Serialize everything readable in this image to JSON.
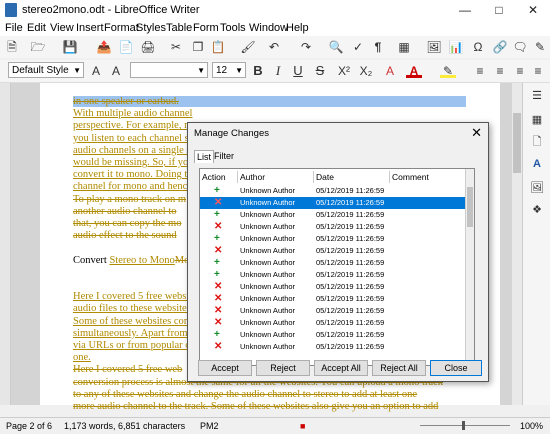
{
  "window": {
    "title": "stereo2mono.odt - LibreOffice Writer"
  },
  "menu": [
    "File",
    "Edit",
    "View",
    "Insert",
    "Format",
    "Styles",
    "Table",
    "Form",
    "Tools",
    "Window",
    "Help"
  ],
  "formatting": {
    "paragraph_style": "Default Style",
    "font_name": "",
    "font_size": "12"
  },
  "document": {
    "lines": [
      {
        "text": "in one speaker or earbud.",
        "style": "del sel"
      },
      {
        "text": "With multiple audio channel",
        "style": "ins"
      },
      {
        "text": "perspective. For example, m",
        "style": "ins"
      },
      {
        "text": "you listen to each channel s",
        "style": "ins"
      },
      {
        "text": "audio channels on a single s",
        "style": "ins"
      },
      {
        "text": "would be missing. So, if you",
        "style": "ins"
      },
      {
        "text": "convert it to mono. Doing th",
        "style": "ins"
      },
      {
        "text": "channel for mono and hence",
        "style": "ins"
      },
      {
        "text": "To play a mono track on m",
        "style": "del"
      },
      {
        "text": "another audio channel to",
        "style": "del"
      },
      {
        "text": "that, you can copy the mo",
        "style": "del"
      },
      {
        "text": "audio effect to the sound",
        "style": "del"
      },
      {
        "text": "",
        "style": ""
      },
      {
        "text": "Convert Stereo to MonoMo",
        "style": "mixed"
      },
      {
        "text": "",
        "style": ""
      },
      {
        "text": "",
        "style": ""
      },
      {
        "text": "Here I covered 5 free websit",
        "style": "ins"
      },
      {
        "text": "audio files to these websites",
        "style": "ins"
      },
      {
        "text": "Some of these websites conv",
        "style": "ins"
      },
      {
        "text": "simultaneously. Apart from",
        "style": "ins"
      },
      {
        "text": "via URLs or from popular cl",
        "style": "ins"
      },
      {
        "text": "one.",
        "style": "ins"
      },
      {
        "text": "Here I covered 5 free web",
        "style": "del"
      },
      {
        "text": "conversion process is almost the same for all the websites. You can upload a mono track",
        "style": "del"
      },
      {
        "text": "to any of these websites and change the audio channel to stereo to add at least one",
        "style": "del"
      },
      {
        "text": "more audio channel to the track. Some of these websites also give you an option to add",
        "style": "del"
      }
    ],
    "convert_prefix": "Convert ",
    "convert_ins": "Stereo to Mono",
    "convert_del": "Mo"
  },
  "dialog": {
    "title": "Manage Changes",
    "close": "✕",
    "tabs": [
      "List",
      "Filter"
    ],
    "columns": [
      "Action",
      "Author",
      "Date",
      "Comment"
    ],
    "rows": [
      {
        "action": "accept",
        "author": "Unknown Author",
        "date": "05/12/2019 11:26:59",
        "comment": ""
      },
      {
        "action": "reject",
        "author": "Unknown Author",
        "date": "05/12/2019 11:26:59",
        "comment": "",
        "selected": true
      },
      {
        "action": "accept",
        "author": "Unknown Author",
        "date": "05/12/2019 11:26:59",
        "comment": ""
      },
      {
        "action": "reject",
        "author": "Unknown Author",
        "date": "05/12/2019 11:26:59",
        "comment": ""
      },
      {
        "action": "accept",
        "author": "Unknown Author",
        "date": "05/12/2019 11:26:59",
        "comment": ""
      },
      {
        "action": "reject",
        "author": "Unknown Author",
        "date": "05/12/2019 11:26:59",
        "comment": ""
      },
      {
        "action": "accept",
        "author": "Unknown Author",
        "date": "05/12/2019 11:26:59",
        "comment": ""
      },
      {
        "action": "accept",
        "author": "Unknown Author",
        "date": "05/12/2019 11:26:59",
        "comment": ""
      },
      {
        "action": "reject",
        "author": "Unknown Author",
        "date": "05/12/2019 11:26:59",
        "comment": ""
      },
      {
        "action": "reject",
        "author": "Unknown Author",
        "date": "05/12/2019 11:26:59",
        "comment": ""
      },
      {
        "action": "reject",
        "author": "Unknown Author",
        "date": "05/12/2019 11:26:59",
        "comment": ""
      },
      {
        "action": "reject",
        "author": "Unknown Author",
        "date": "05/12/2019 11:26:59",
        "comment": ""
      },
      {
        "action": "accept",
        "author": "Unknown Author",
        "date": "05/12/2019 11:26:59",
        "comment": ""
      },
      {
        "action": "reject",
        "author": "Unknown Author",
        "date": "05/12/2019 11:26:59",
        "comment": ""
      }
    ],
    "buttons": {
      "accept": "Accept",
      "reject": "Reject",
      "accept_all": "Accept All",
      "reject_all": "Reject All",
      "close": "Close"
    }
  },
  "status": {
    "page": "Page 2 of 6",
    "words": "1,173 words, 6,851 characters",
    "mode": "PM2",
    "zoom": "100%"
  },
  "colors": {
    "tracked_change": "#b08a00",
    "selection": "#0078d7",
    "accept_icon": "#138a2b",
    "reject_icon": "#dd1111"
  }
}
